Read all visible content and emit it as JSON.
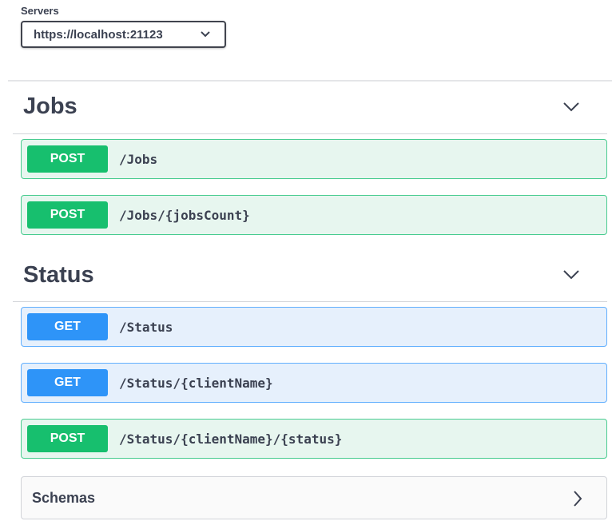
{
  "servers": {
    "label": "Servers",
    "selected": "https://localhost:21123",
    "icon": "chevron-down-icon"
  },
  "sections": [
    {
      "title": "Jobs",
      "icon": "chevron-down-icon",
      "operations": [
        {
          "method": "POST",
          "path": "/Jobs"
        },
        {
          "method": "POST",
          "path": "/Jobs/{jobsCount}"
        }
      ]
    },
    {
      "title": "Status",
      "icon": "chevron-down-icon",
      "operations": [
        {
          "method": "GET",
          "path": "/Status"
        },
        {
          "method": "GET",
          "path": "/Status/{clientName}"
        },
        {
          "method": "POST",
          "path": "/Status/{clientName}/{status}"
        }
      ]
    }
  ],
  "schemas": {
    "label": "Schemas",
    "icon": "chevron-right-icon"
  },
  "colors": {
    "post_bg": "#e7f6ef",
    "post_border": "#49cc90",
    "post_method": "#17bf6e",
    "get_bg": "#e6f0fc",
    "get_border": "#61affe",
    "get_method": "#2e94f8",
    "text": "#3b4151"
  }
}
